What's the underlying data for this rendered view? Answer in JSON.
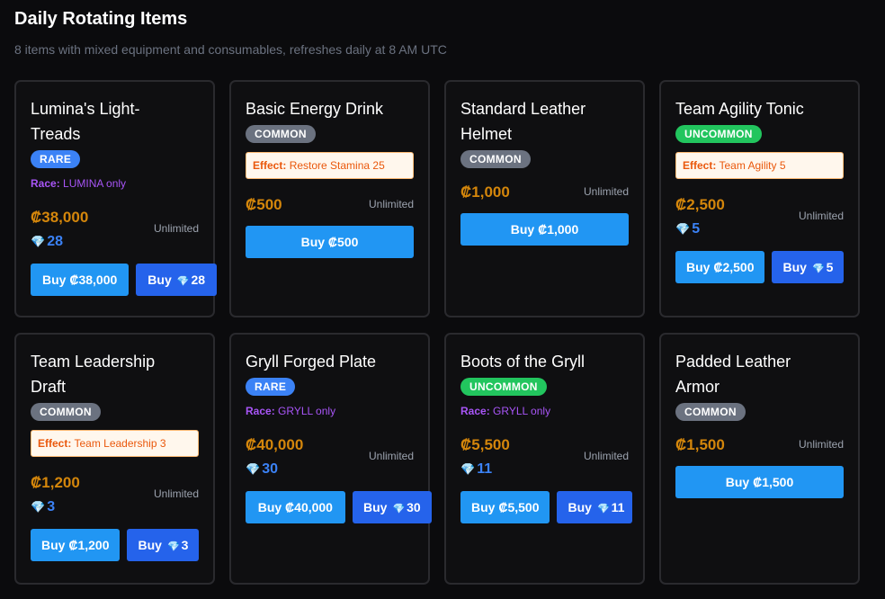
{
  "header": {
    "title": "Daily Rotating Items",
    "subtitle": "8 items with mixed equipment and consumables, refreshes daily at 8 AM UTC"
  },
  "colors": {
    "credits": "#d4860b",
    "gems": "#3b82f6",
    "rare": "#3b82f6",
    "common": "#6b7280",
    "uncommon": "#22c55e",
    "race": "#a855f7",
    "button_primary": "#2196f3",
    "button_gem": "#2563eb"
  },
  "icons": {
    "gem": "gem-icon"
  },
  "items": [
    {
      "name": "Lumina's Light-Treads",
      "rarity": "RARE",
      "race_label": "Race:",
      "race": "LUMINA only",
      "credits": "₡38,000",
      "gems": "28",
      "stock": "Unlimited",
      "buy_credit": "Buy ₡38,000",
      "buy_label": "Buy",
      "buy_gems": "28"
    },
    {
      "name": "Basic Energy Drink",
      "rarity": "COMMON",
      "effect_label": "Effect:",
      "effect": "Restore Stamina 25",
      "credits": "₡500",
      "stock": "Unlimited",
      "buy_credit": "Buy ₡500"
    },
    {
      "name": "Standard Leather Helmet",
      "rarity": "COMMON",
      "credits": "₡1,000",
      "stock": "Unlimited",
      "buy_credit": "Buy ₡1,000"
    },
    {
      "name": "Team Agility Tonic",
      "rarity": "UNCOMMON",
      "effect_label": "Effect:",
      "effect": "Team Agility 5",
      "credits": "₡2,500",
      "gems": "5",
      "stock": "Unlimited",
      "buy_credit": "Buy ₡2,500",
      "buy_label": "Buy",
      "buy_gems": "5"
    },
    {
      "name": "Team Leadership Draft",
      "rarity": "COMMON",
      "effect_label": "Effect:",
      "effect": "Team Leadership 3",
      "credits": "₡1,200",
      "gems": "3",
      "stock": "Unlimited",
      "buy_credit": "Buy ₡1,200",
      "buy_label": "Buy",
      "buy_gems": "3"
    },
    {
      "name": "Gryll Forged Plate",
      "rarity": "RARE",
      "race_label": "Race:",
      "race": "GRYLL only",
      "credits": "₡40,000",
      "gems": "30",
      "stock": "Unlimited",
      "buy_credit": "Buy ₡40,000",
      "buy_label": "Buy",
      "buy_gems": "30"
    },
    {
      "name": "Boots of the Gryll",
      "rarity": "UNCOMMON",
      "race_label": "Race:",
      "race": "GRYLL only",
      "credits": "₡5,500",
      "gems": "11",
      "stock": "Unlimited",
      "buy_credit": "Buy ₡5,500",
      "buy_label": "Buy",
      "buy_gems": "11"
    },
    {
      "name": "Padded Leather Armor",
      "rarity": "COMMON",
      "credits": "₡1,500",
      "stock": "Unlimited",
      "buy_credit": "Buy ₡1,500"
    }
  ]
}
